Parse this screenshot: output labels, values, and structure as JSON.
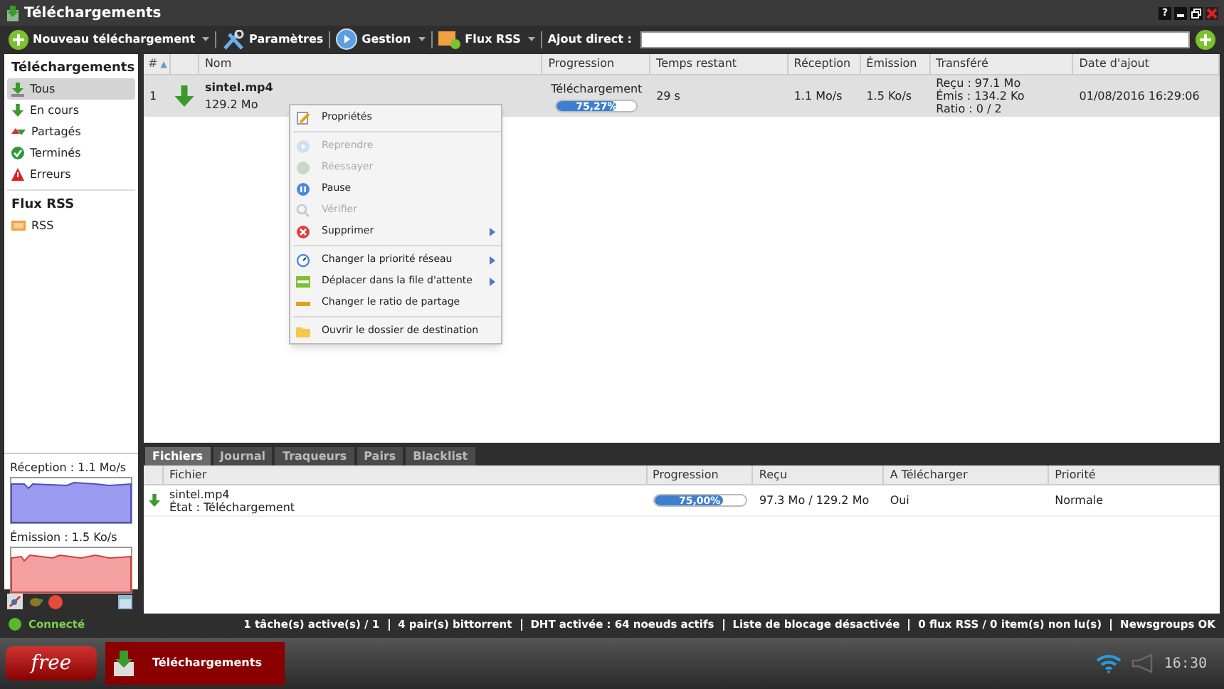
{
  "window": {
    "title": "Téléchargements",
    "help": "?"
  },
  "toolbar": {
    "buttons": [
      {
        "label": "Nouveau téléchargement",
        "dropdown": true
      },
      {
        "label": "Paramètres",
        "dropdown": false
      },
      {
        "label": "Gestion",
        "dropdown": true
      },
      {
        "label": "Flux RSS",
        "dropdown": true
      }
    ],
    "direct_add": {
      "label": "Ajout direct :"
    }
  },
  "sidebar": {
    "sections": [
      {
        "title": "Téléchargements",
        "items": [
          {
            "label": "Tous",
            "selected": true
          },
          {
            "label": "En cours",
            "selected": false
          },
          {
            "label": "Partagés",
            "selected": false
          },
          {
            "label": "Terminés",
            "selected": false
          },
          {
            "label": "Erreurs",
            "selected": false
          }
        ]
      },
      {
        "title": "Flux RSS",
        "items": [
          {
            "label": "RSS",
            "selected": false
          }
        ]
      }
    ],
    "reception": "Réception : 1.1 Mo/s",
    "emission": "Émission : 1.5 Ko/s"
  },
  "table": {
    "columns": [
      "#",
      "Nom",
      "Progression",
      "Temps restant",
      "Réception",
      "Émission",
      "Transféré",
      "Date d'ajout"
    ],
    "sort_mark": "▲",
    "rows": [
      {
        "selected": true,
        "index": "1",
        "name": "sintel.mp4",
        "size": "129.2 Mo",
        "state": "Téléchargement",
        "level": 0.7527,
        "percent": "75,27%",
        "remaining": "29 s",
        "reception": "1.1 Mo/s",
        "emission": "1.5 Ko/s",
        "transferred": [
          "Reçu : 97.1 Mo",
          "Émis : 134.2 Ko",
          "Ratio : 0 / 2"
        ],
        "date": "01/08/2016 16:29:06"
      }
    ]
  },
  "context_menu": {
    "groups": [
      [
        {
          "label": "Propriétés",
          "disabled": false,
          "submenu": false
        }
      ],
      [
        {
          "label": "Reprendre",
          "disabled": true,
          "submenu": false
        },
        {
          "label": "Réessayer",
          "disabled": true,
          "submenu": false
        },
        {
          "label": "Pause",
          "disabled": false,
          "submenu": false
        },
        {
          "label": "Vérifier",
          "disabled": true,
          "submenu": false
        },
        {
          "label": "Supprimer",
          "disabled": false,
          "submenu": true
        }
      ],
      [
        {
          "label": "Changer la priorité réseau",
          "disabled": false,
          "submenu": true
        },
        {
          "label": "Déplacer dans la file d'attente",
          "disabled": false,
          "submenu": true
        },
        {
          "label": "Changer le ratio de partage",
          "disabled": false,
          "submenu": false
        }
      ],
      [
        {
          "label": "Ouvrir le dossier de destination",
          "disabled": false,
          "submenu": false
        }
      ]
    ]
  },
  "detail_tabs": [
    {
      "label": "Fichiers",
      "selected": true
    },
    {
      "label": "Journal",
      "selected": false
    },
    {
      "label": "Traqueurs",
      "selected": false
    },
    {
      "label": "Pairs",
      "selected": false
    },
    {
      "label": "Blacklist",
      "selected": false
    }
  ],
  "files": {
    "columns": [
      "Fichier",
      "Progression",
      "Reçu",
      "A Télécharger",
      "Priorité"
    ],
    "rows": [
      {
        "name": "sintel.mp4",
        "state": "État : Téléchargement",
        "level": 0.75,
        "percent": "75,00%",
        "received": "97.3 Mo / 129.2 Mo",
        "download": "Oui",
        "priority": "Normale"
      }
    ]
  },
  "status_bar": {
    "connection": "Connecté",
    "items": [
      "1 tâche(s) active(s) / 1",
      "4 pair(s) bittorrent",
      "DHT activée : 64 noeuds actifs",
      "Liste de blocage désactivée",
      "0 flux RSS / 0 item(s) non lu(s)",
      "Newsgroups OK"
    ]
  },
  "taskbar": {
    "logo": "free",
    "app": "Téléchargements",
    "clock": "16:30"
  }
}
